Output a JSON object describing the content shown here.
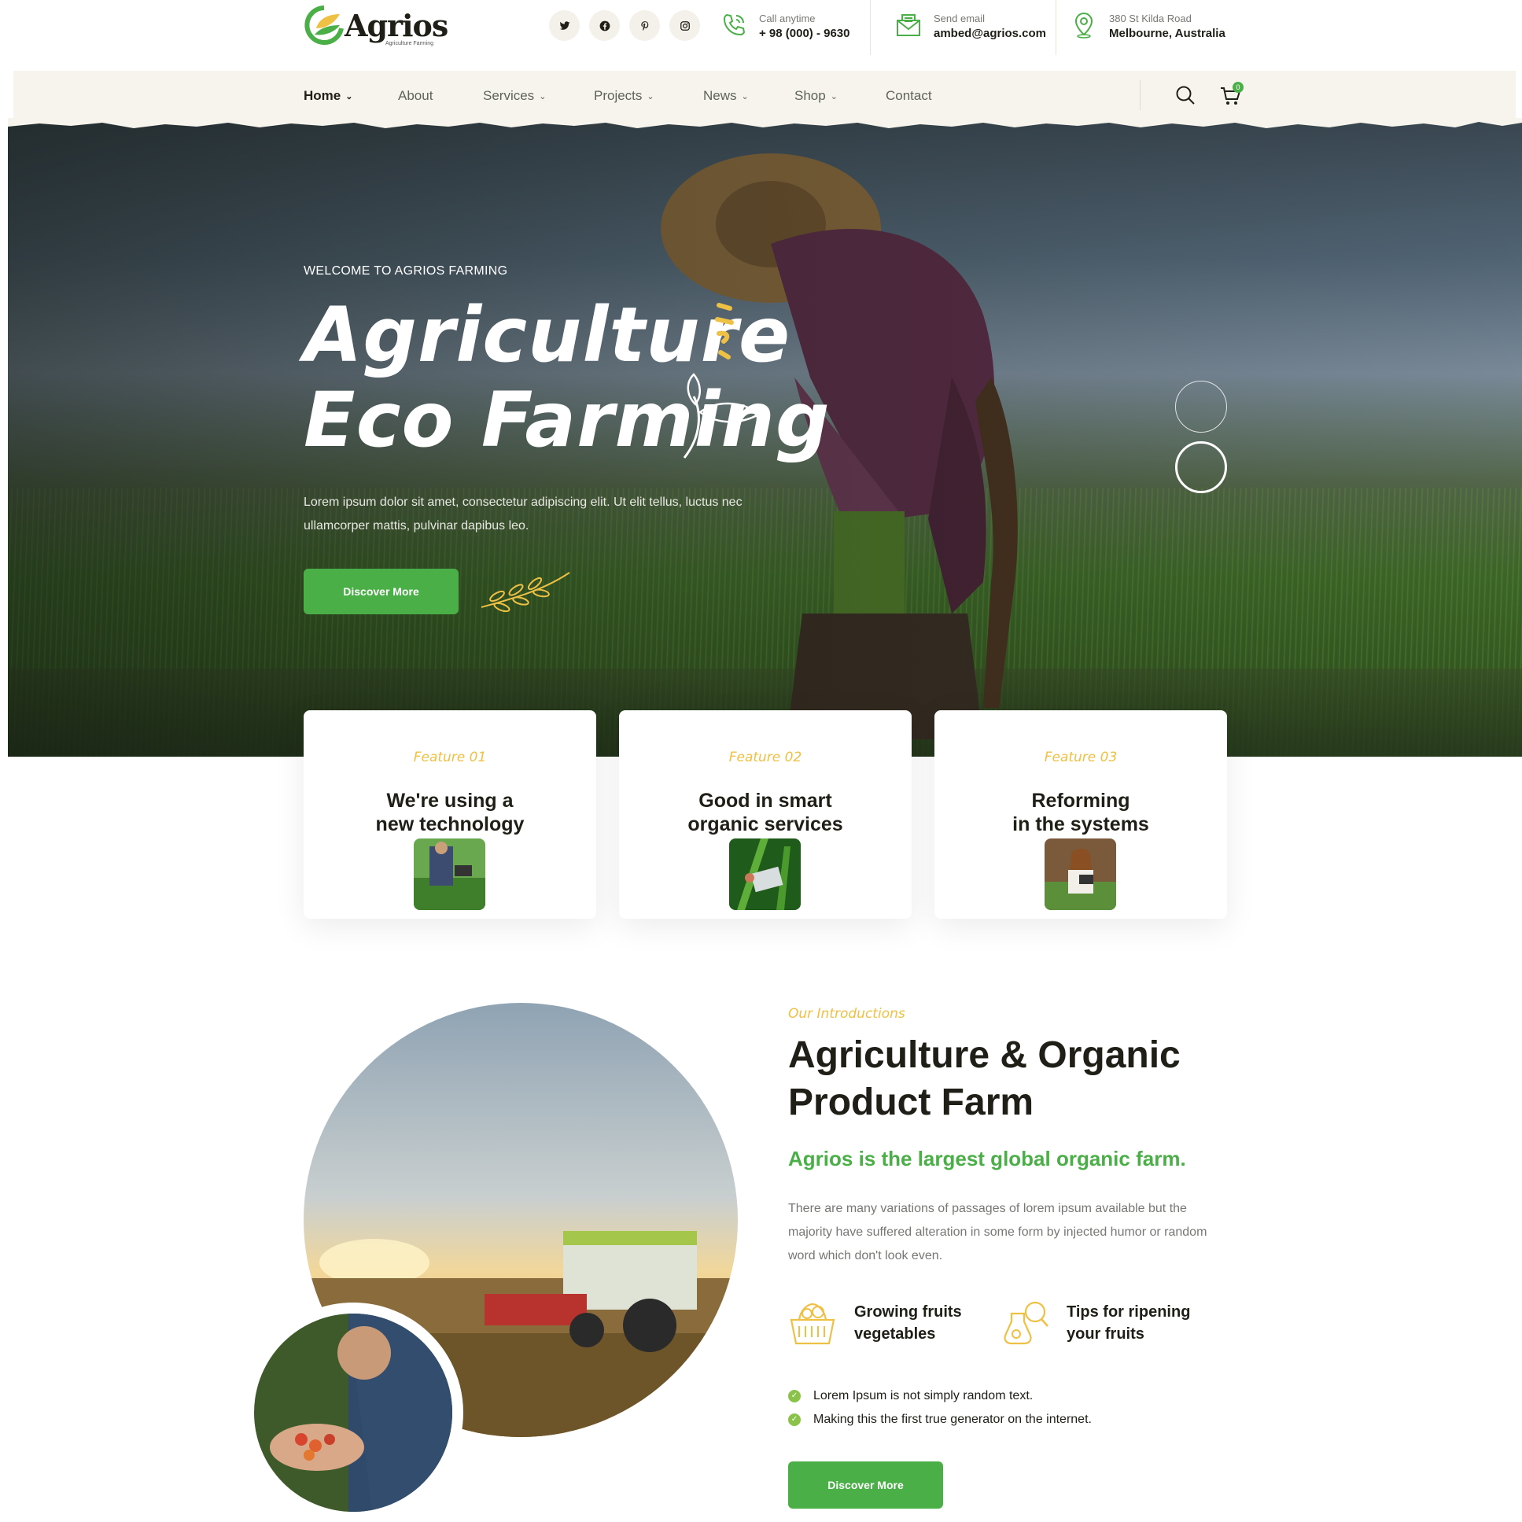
{
  "brand": {
    "name": "Agrios",
    "tagline": "Agriculture Farming"
  },
  "socials": [
    {
      "icon": "twitter-icon"
    },
    {
      "icon": "facebook-icon"
    },
    {
      "icon": "pinterest-icon"
    },
    {
      "icon": "instagram-icon"
    }
  ],
  "contact": {
    "phone": {
      "label": "Call anytime",
      "value": "+ 98 (000) - 9630"
    },
    "email": {
      "label": "Send email",
      "value": "ambed@agrios.com"
    },
    "address": {
      "label": "380 St Kilda Road",
      "value": "Melbourne, Australia"
    }
  },
  "nav": {
    "items": [
      {
        "label": "Home",
        "dropdown": true,
        "active": true
      },
      {
        "label": "About",
        "dropdown": false
      },
      {
        "label": "Services",
        "dropdown": true
      },
      {
        "label": "Projects",
        "dropdown": true
      },
      {
        "label": "News",
        "dropdown": true
      },
      {
        "label": "Shop",
        "dropdown": true
      },
      {
        "label": "Contact",
        "dropdown": false
      }
    ],
    "cart_count": "0"
  },
  "hero": {
    "kicker": "WELCOME TO AGRIOS FARMING",
    "title_line1": "Agriculture",
    "title_line2": "Eco Farming",
    "description": "Lorem ipsum dolor sit amet, consectetur adipiscing elit. Ut elit tellus, luctus nec ullamcorper mattis, pulvinar dapibus leo.",
    "button": "Discover More",
    "slide_count": 2,
    "active_slide": 2
  },
  "features": [
    {
      "kicker": "Feature 01",
      "title_line1": "We're using a",
      "title_line2": "new technology"
    },
    {
      "kicker": "Feature 02",
      "title_line1": "Good in smart",
      "title_line2": "organic services"
    },
    {
      "kicker": "Feature 03",
      "title_line1": "Reforming",
      "title_line2": "in the systems"
    }
  ],
  "intro": {
    "kicker": "Our Introductions",
    "title_line1": "Agriculture & Organic",
    "title_line2": "Product Farm",
    "subtitle": "Agrios is the largest global organic farm.",
    "text": "There are many variations of passages of lorem ipsum available but the majority have suffered alteration in some form by injected humor or random word which don't look even.",
    "perks": [
      {
        "icon": "fruit-basket-icon",
        "line1": "Growing fruits",
        "line2": "vegetables"
      },
      {
        "icon": "ripening-tips-icon",
        "line1": "Tips for ripening",
        "line2": "your fruits"
      }
    ],
    "checklist": [
      "Lorem Ipsum is not simply random text.",
      "Making this the first true generator on the internet."
    ],
    "button": "Discover More"
  },
  "colors": {
    "green": "#4baf47",
    "yellow": "#eec044",
    "dark": "#1f1e17",
    "cream": "#f6f4ec"
  }
}
